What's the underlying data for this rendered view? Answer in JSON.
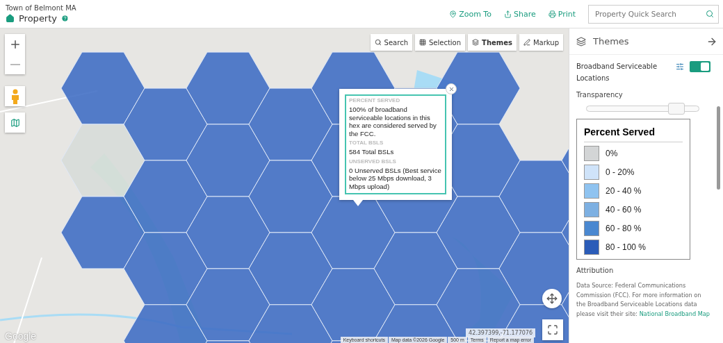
{
  "header": {
    "town": "Town of Belmont MA",
    "title": "Property",
    "actions": [
      {
        "label": "Zoom To",
        "kind": "pin"
      },
      {
        "label": "Share",
        "kind": "share"
      },
      {
        "label": "Print",
        "kind": "print"
      }
    ],
    "search": {
      "placeholder": "Property Quick Search"
    }
  },
  "map_toolbar": [
    {
      "label": "Search",
      "kind": "search",
      "selected": false
    },
    {
      "label": "Selection",
      "kind": "grid",
      "selected": false
    },
    {
      "label": "Themes",
      "kind": "layers",
      "selected": true
    },
    {
      "label": "Markup",
      "kind": "pen",
      "selected": false
    }
  ],
  "popup": {
    "sections": [
      {
        "label": "PERCENT SERVED",
        "value": "100% of broadband serviceable locations in this hex are considered served by the FCC."
      },
      {
        "label": "TOTAL BSLS",
        "value": "584 Total BSLs"
      },
      {
        "label": "UNSERVED BSLS",
        "value": "0 Unserved BSLs (Best service below 25 Mbps download, 3 Mbps upload)"
      }
    ]
  },
  "map_footer": {
    "coordinates": "42.397399,-71.177076",
    "google": "Google",
    "links": [
      "Keyboard shortcuts",
      "Map data ©2026 Google",
      "500 m",
      "Terms",
      "Report a map error"
    ]
  },
  "panel": {
    "title": "Themes",
    "layer": {
      "name": "Broadband Serviceable Locations",
      "on": true
    },
    "transparency": {
      "label": "Transparency",
      "level": 0.8
    },
    "legend": {
      "title": "Percent Served",
      "items": [
        {
          "label": "0%",
          "color": "#d3d5d6"
        },
        {
          "label": "0 - 20%",
          "color": "#cfe3f9"
        },
        {
          "label": "20 - 40 %",
          "color": "#8fc3f0"
        },
        {
          "label": "40 - 60 %",
          "color": "#7db0e2"
        },
        {
          "label": "60 - 80 %",
          "color": "#4a88d0"
        },
        {
          "label": "80 - 100 %",
          "color": "#2b5cb8"
        }
      ]
    },
    "attribution": {
      "title": "Attribution",
      "text": "Data Source: Federal Communications Commission (FCC). For more information on the Broadband Serviceable Locations data please visit their site:",
      "link": "National Broadband Map"
    }
  }
}
